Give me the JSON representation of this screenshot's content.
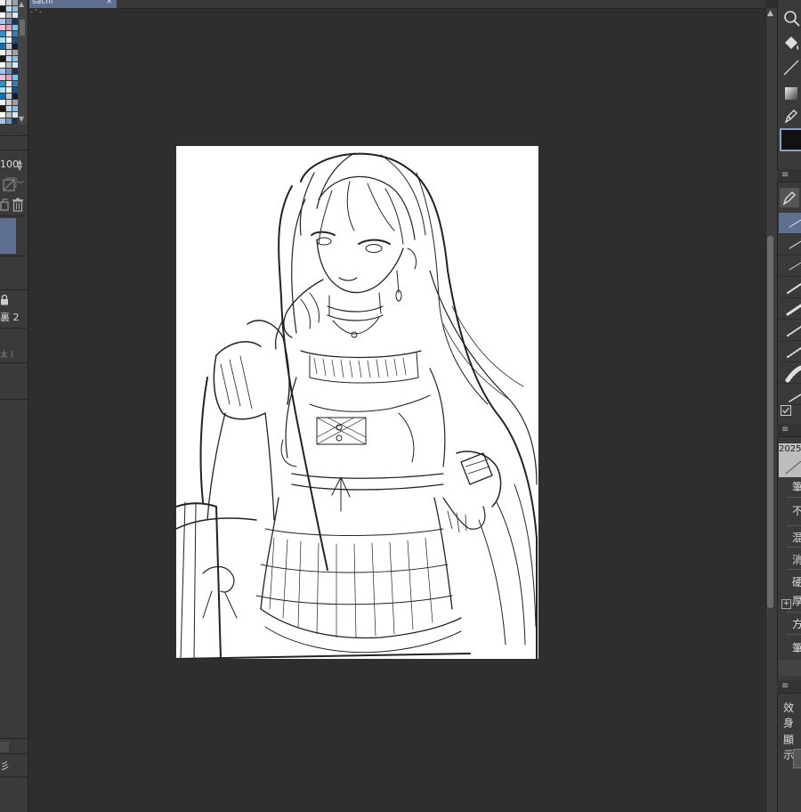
{
  "document": {
    "tab_name": "sachi",
    "close_glyph": "×"
  },
  "ruler": {
    "marks": "- ' -"
  },
  "left_panel": {
    "palette_colors": [
      "#f0f0f0",
      "#d0d0d0",
      "#a0a0a0",
      "#1a1a1a",
      "#c0d8f0",
      "#88bde8",
      "#ffffff",
      "#bbbbbb",
      "#d8e8f8",
      "#a8c0e8",
      "#7090c0",
      "#203050",
      "#f0c0d0",
      "#e0a0c0",
      "#70c8e8",
      "#3090c0",
      "#e8e8e8",
      "#4078b0",
      "#a0e0f0",
      "#ffffff",
      "#205080",
      "#1070b0",
      "#c8c8c8",
      "#0c1c3a"
    ],
    "opacity_value": "100",
    "layer_label_2": "裏 2",
    "layer_label_3": "太 (",
    "bottom_label": "彡"
  },
  "right_panel": {
    "prop_date": "2025",
    "prop_labels": [
      "筆",
      "不",
      "混",
      "消",
      "硬",
      "厚",
      "方",
      "筆"
    ],
    "effect_label": "效身",
    "display_label": "顯示"
  },
  "colors": {
    "accent": "#5f6f8f",
    "canvas": "#ffffff",
    "workspace": "#2e2e2e",
    "main_color": "#111111"
  }
}
